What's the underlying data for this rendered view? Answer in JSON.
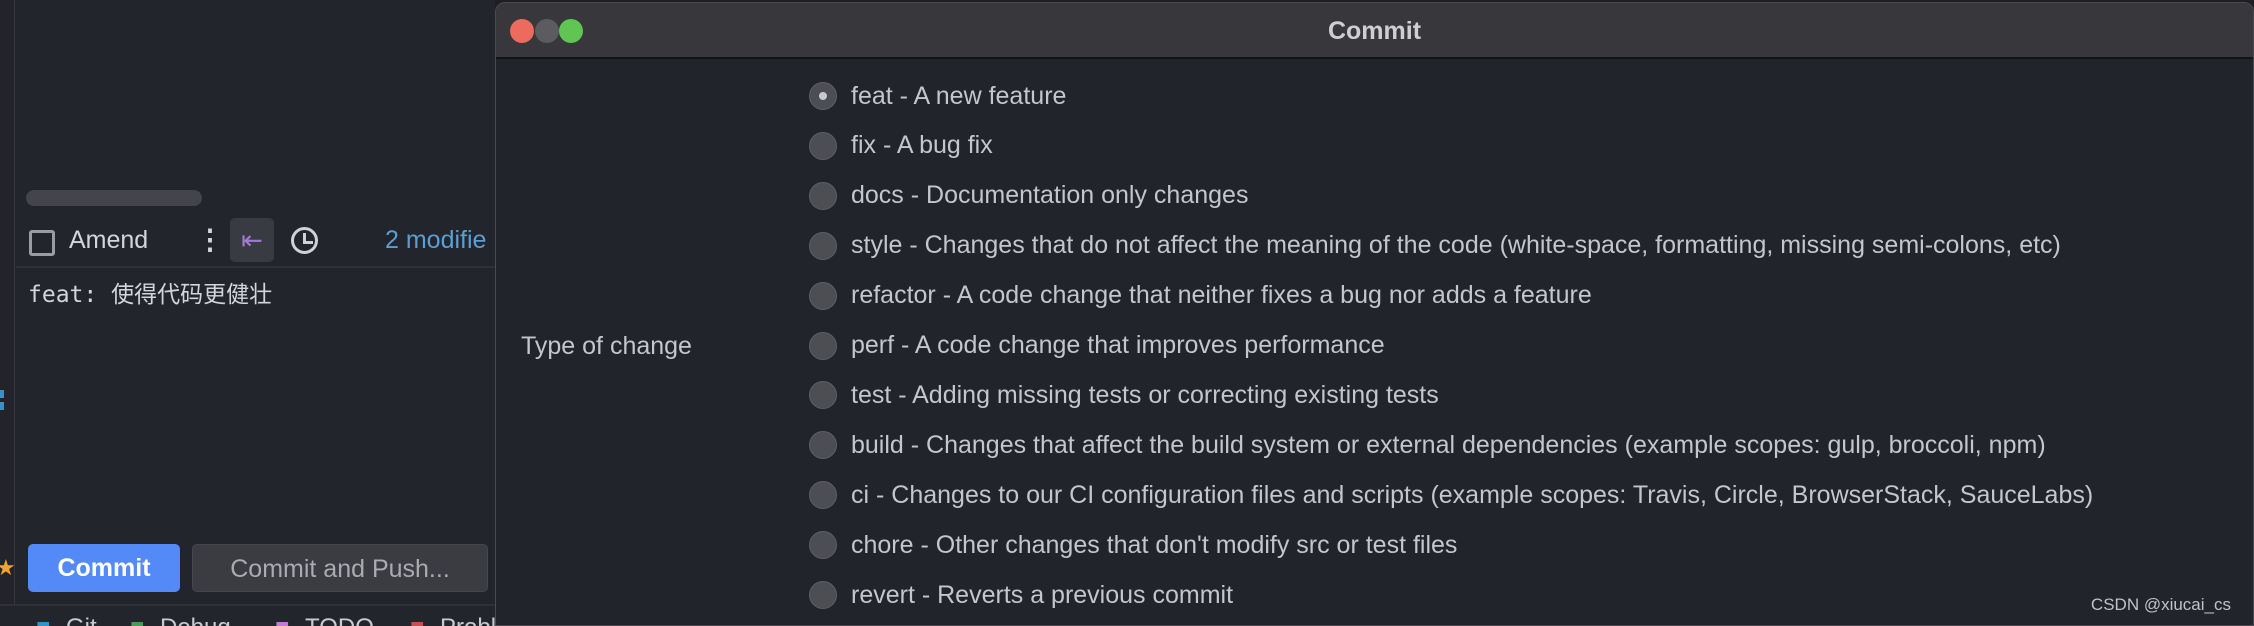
{
  "left_panel": {
    "amend_label": "Amend",
    "amend_checked": false,
    "modified_text": "2 modifie",
    "commit_message": "feat: 使得代码更健壮",
    "commit_button": "Commit",
    "commit_push_button": "Commit and Push...",
    "bottom_tabs": [
      {
        "label": "Git",
        "color": "#3592c4"
      },
      {
        "label": "Debug",
        "color": "#499c54"
      },
      {
        "label": "TODO",
        "color": "#c57bd6"
      },
      {
        "label": "Probl",
        "color": "#c94f4f"
      }
    ]
  },
  "dialog": {
    "title": "Commit",
    "field_label": "Type of change",
    "selected": 0,
    "options": [
      "feat - A new feature",
      "fix - A bug fix",
      "docs - Documentation only changes",
      "style - Changes that do not affect the meaning of the code (white-space, formatting, missing semi-colons, etc)",
      "refactor - A code change that neither fixes a bug nor adds a feature",
      "perf - A code change that improves performance",
      "test - Adding missing tests or correcting existing tests",
      "build - Changes that affect the build system or external dependencies (example scopes: gulp, broccoli, npm)",
      "ci - Changes to our CI configuration files and scripts (example scopes: Travis, Circle, BrowserStack, SauceLabs)",
      "chore - Other changes that don't modify src or test files",
      "revert - Reverts a previous commit"
    ]
  },
  "watermark": "CSDN @xiucai_cs",
  "colors": {
    "accent": "#548af7",
    "modified": "#5a9fd4"
  }
}
